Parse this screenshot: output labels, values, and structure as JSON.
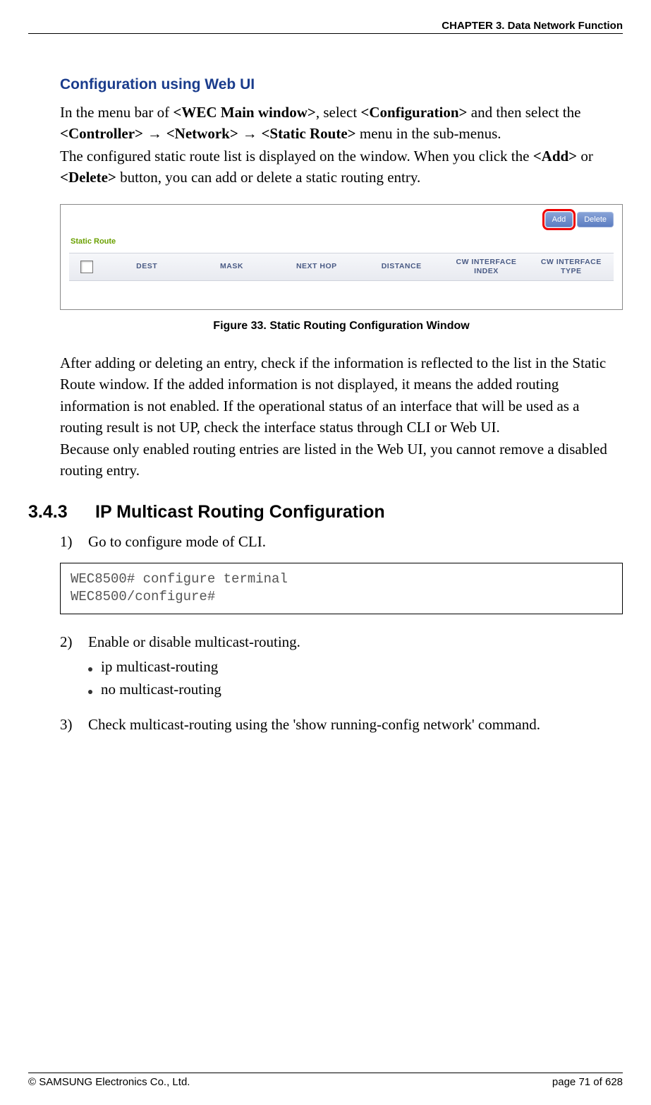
{
  "header": {
    "chapter": "CHAPTER 3. Data Network Function"
  },
  "section1": {
    "title": "Configuration using Web UI",
    "p1_a": "In the menu bar of ",
    "p1_b1": "<WEC Main window>",
    "p1_c": ", select ",
    "p1_b2": "<Configuration>",
    "p1_d": " and then select the ",
    "p1_b3": "<Controller>",
    "p1_arrow": " → ",
    "p1_b4": "<Network>",
    "p1_b5": "<Static Route>",
    "p1_e": " menu in the sub-menus.",
    "p2_a": "The configured static route list is displayed on the window. When you click the ",
    "p2_b1": "<Add>",
    "p2_b": " or ",
    "p2_b2": "<Delete>",
    "p2_c": " button, you can add or delete a static routing entry."
  },
  "figure": {
    "add_btn": "Add",
    "delete_btn": "Delete",
    "label": "Static Route",
    "cols": {
      "dest": "DEST",
      "mask": "MASK",
      "nexthop": "NEXT HOP",
      "distance": "DISTANCE",
      "cwidx": "CW INTERFACE INDEX",
      "cwtype": "CW INTERFACE TYPE"
    },
    "caption": "Figure 33. Static Routing Configuration Window"
  },
  "section1b": {
    "p1": "After adding or deleting an entry, check if the information is reflected to the list in the Static Route window. If the added information is not displayed, it means the added routing information is not enabled. If the operational status of an interface that will be used as a routing result is not UP, check the interface status through CLI or Web UI.",
    "p2": "Because only enabled routing entries are listed in the Web UI, you cannot remove a disabled routing entry."
  },
  "section2": {
    "num": "3.4.3",
    "title": "IP Multicast Routing Configuration",
    "step1_num": "1)",
    "step1": "Go to configure mode of CLI.",
    "code": "WEC8500# configure terminal\nWEC8500/configure#",
    "step2_num": "2)",
    "step2": "Enable or disable multicast-routing.",
    "bullet1": "ip multicast-routing",
    "bullet2": "no multicast-routing",
    "step3_num": "3)",
    "step3": "Check multicast-routing using the 'show running-config network' command."
  },
  "footer": {
    "left": "© SAMSUNG Electronics Co., Ltd.",
    "right": "page 71 of 628"
  }
}
